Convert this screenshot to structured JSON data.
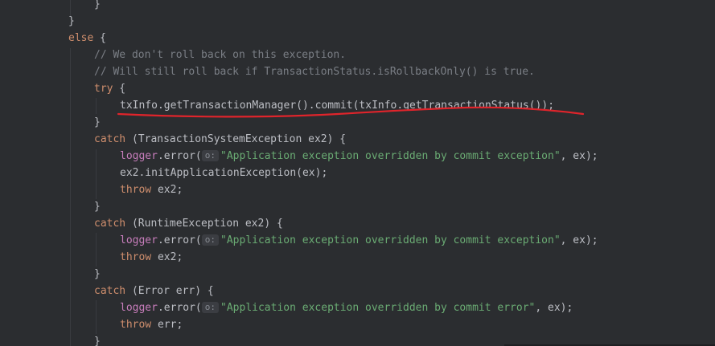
{
  "editor": {
    "theme_colors": {
      "background": "#2b2d30",
      "keyword": "#cf8e6d",
      "comment": "#7a7e85",
      "string": "#6aab73",
      "field": "#c77dbb",
      "text": "#bcbec4",
      "annotation": "#e0242b"
    },
    "lines": [
      {
        "id": "l0",
        "text": "}"
      },
      {
        "id": "l1",
        "text": "}"
      },
      {
        "id": "l2",
        "kw": "else",
        "rest": " {"
      },
      {
        "id": "l3",
        "text": "// We don't roll back on this exception."
      },
      {
        "id": "l4",
        "text": "// Will still roll back if TransactionStatus.isRollbackOnly() is true."
      },
      {
        "id": "l5",
        "kw": "try",
        "rest": " {"
      },
      {
        "id": "l6",
        "text": "txInfo.getTransactionManager().commit(txInfo.getTransactionStatus());"
      },
      {
        "id": "l7",
        "text": "}"
      },
      {
        "id": "l8",
        "kw": "catch",
        "rest": " (TransactionSystemException ex2) {"
      },
      {
        "id": "l9",
        "field": "logger",
        "pre": ".error(",
        "hint": "o:",
        "str": "\"Application exception overridden by commit exception\"",
        "post": ", ex);"
      },
      {
        "id": "l10",
        "text": "ex2.initApplicationException(ex);"
      },
      {
        "id": "l11",
        "kw": "throw",
        "rest": " ex2;"
      },
      {
        "id": "l12",
        "text": "}"
      },
      {
        "id": "l13",
        "kw": "catch",
        "rest": " (RuntimeException ex2) {"
      },
      {
        "id": "l14",
        "field": "logger",
        "pre": ".error(",
        "hint": "o:",
        "str": "\"Application exception overridden by commit exception\"",
        "post": ", ex);"
      },
      {
        "id": "l15",
        "kw": "throw",
        "rest": " ex2;"
      },
      {
        "id": "l16",
        "text": "}"
      },
      {
        "id": "l17",
        "kw": "catch",
        "rest": " (Error err) {"
      },
      {
        "id": "l18",
        "field": "logger",
        "pre": ".error(",
        "hint": "o:",
        "str": "\"Application exception overridden by commit error\"",
        "post": ", ex);"
      },
      {
        "id": "l19",
        "kw": "throw",
        "rest": " err;"
      },
      {
        "id": "l20",
        "text": "}"
      }
    ]
  }
}
